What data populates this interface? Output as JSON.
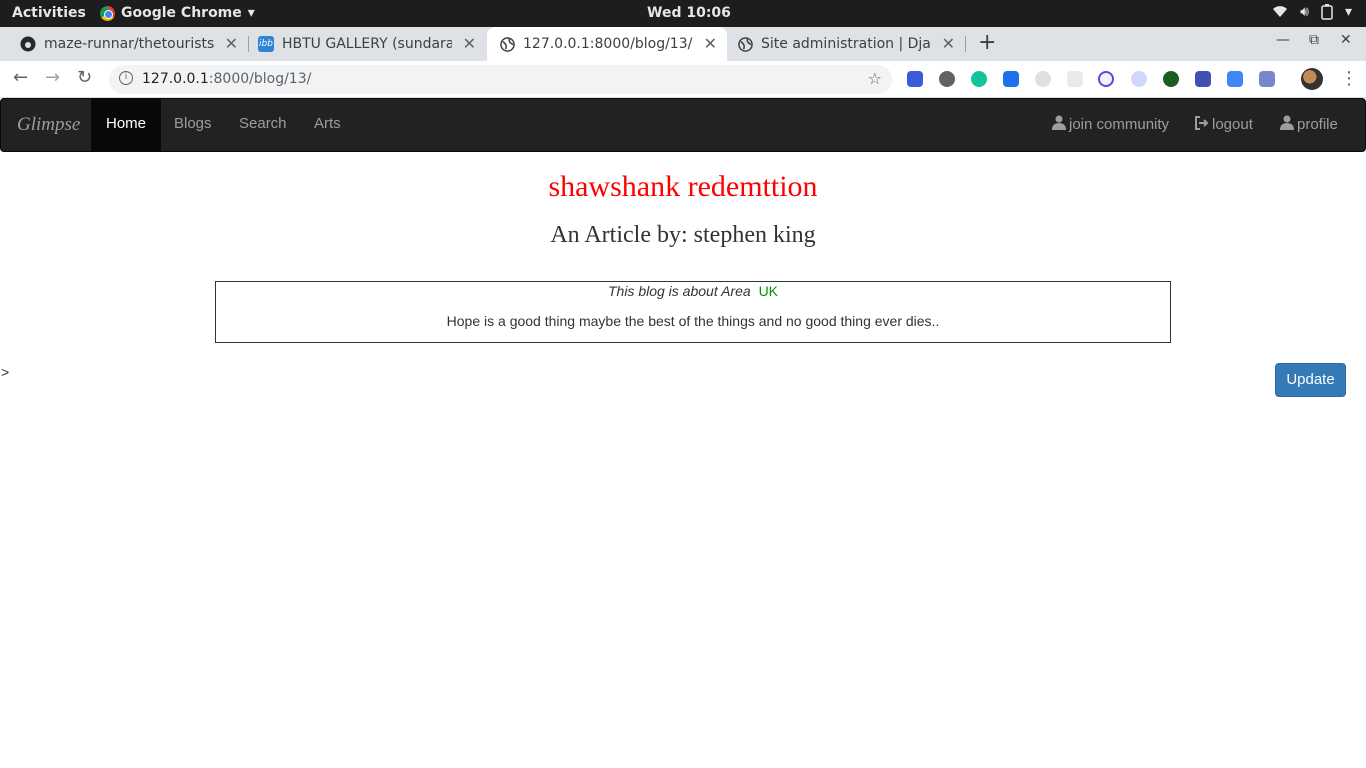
{
  "os_bar": {
    "activities": "Activities",
    "app_name": "Google Chrome",
    "clock": "Wed 10:06"
  },
  "browser": {
    "tabs": [
      {
        "title": "maze-runnar/thetourists",
        "icon": "github-icon",
        "active": false
      },
      {
        "title": "HBTU GALLERY (sundaram",
        "icon": "ibb-icon",
        "active": false
      },
      {
        "title": "127.0.0.1:8000/blog/13/",
        "icon": "globe-icon",
        "active": true
      },
      {
        "title": "Site administration | Djan",
        "icon": "globe-icon",
        "active": false
      }
    ],
    "url_host": "127.0.0.1",
    "url_rest": ":8000/blog/13/"
  },
  "site": {
    "brand": "Glimpse",
    "nav": [
      "Home",
      "Blogs",
      "Search",
      "Arts"
    ],
    "right_nav": {
      "join": "join community",
      "logout": "logout",
      "profile": "profile"
    }
  },
  "post": {
    "title": "shawshank redemttion",
    "byline": "An Article by: stephen king",
    "area_label": "This blog is about Area",
    "area_value": "UK",
    "body": "Hope is a good thing maybe the best of the things and no good thing ever dies..",
    "stray_char": ">",
    "update_label": "Update"
  },
  "colors": {
    "title": "#ff0000",
    "area": "#009900",
    "button": "#337ab7",
    "navbar": "#222222"
  }
}
